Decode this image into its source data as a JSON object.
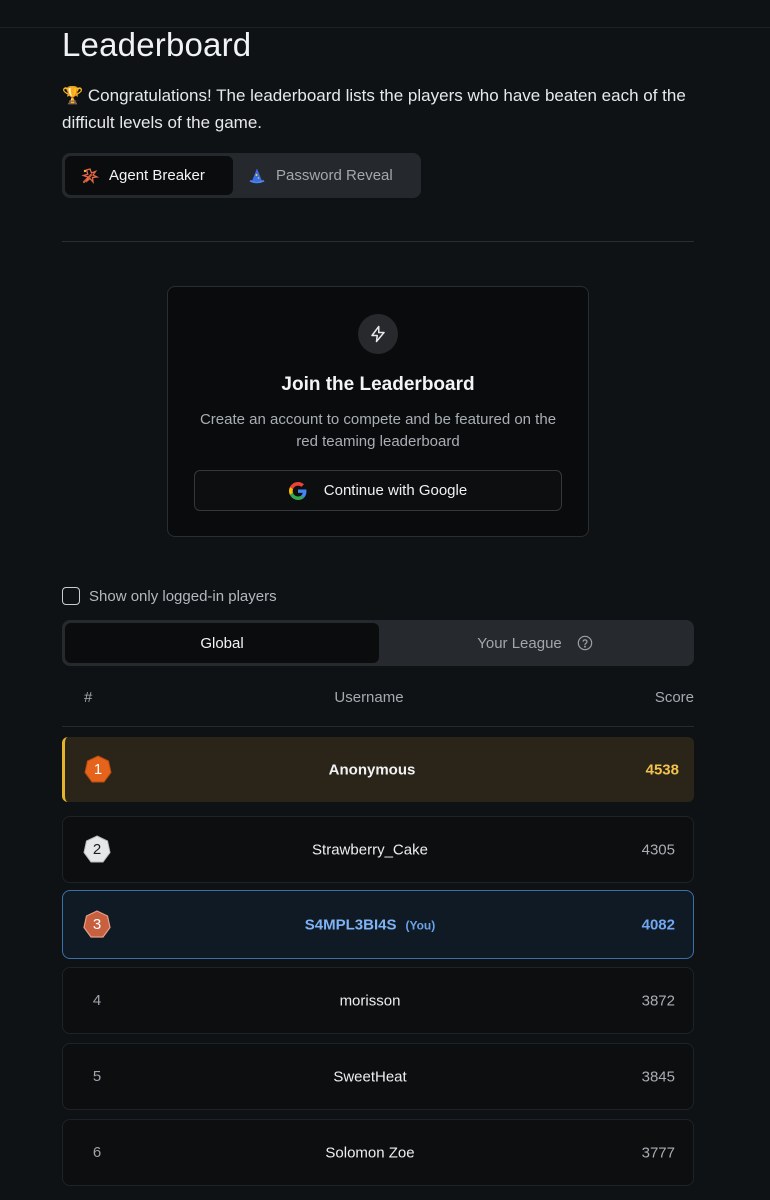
{
  "page": {
    "title": "Leaderboard",
    "intro": "🏆 Congratulations! The leaderboard lists the players who have beaten each of the difficult levels of the game."
  },
  "game_tabs": [
    {
      "label": "Agent Breaker",
      "icon": "agent-breaker-icon",
      "active": true
    },
    {
      "label": "Password Reveal",
      "icon": "wizard-hat-icon",
      "active": false
    }
  ],
  "join_card": {
    "icon": "lightning-bolt-icon",
    "title": "Join the Leaderboard",
    "subtitle": "Create an account to compete and be featured on the red teaming leaderboard",
    "google_button": "Continue with Google"
  },
  "filter": {
    "label": "Show only logged-in players",
    "checked": false
  },
  "scope_tabs": [
    {
      "label": "Global",
      "active": true
    },
    {
      "label": "Your League",
      "active": false,
      "icon": "help-circle-icon"
    }
  ],
  "table": {
    "headers": {
      "rank": "#",
      "username": "Username",
      "score": "Score"
    },
    "rows": [
      {
        "rank": "1",
        "username": "Anonymous",
        "score": "4538",
        "medal": "gold"
      },
      {
        "rank": "2",
        "username": "Strawberry_Cake",
        "score": "4305",
        "medal": "silver"
      },
      {
        "rank": "3",
        "username": "S4MPL3BI4S",
        "you_tag": "(You)",
        "score": "4082",
        "medal": "bronze"
      },
      {
        "rank": "4",
        "username": "morisson",
        "score": "3872"
      },
      {
        "rank": "5",
        "username": "SweetHeat",
        "score": "3845"
      },
      {
        "rank": "6",
        "username": "Solomon Zoe",
        "score": "3777"
      }
    ]
  },
  "colors": {
    "background": "#0f1215",
    "gold_accent": "#e2b52b",
    "you_accent": "#3c6fa8",
    "gold_medal": "#e5631a",
    "silver_medal": "#e6e7e9",
    "bronze_medal": "#c8603f"
  }
}
